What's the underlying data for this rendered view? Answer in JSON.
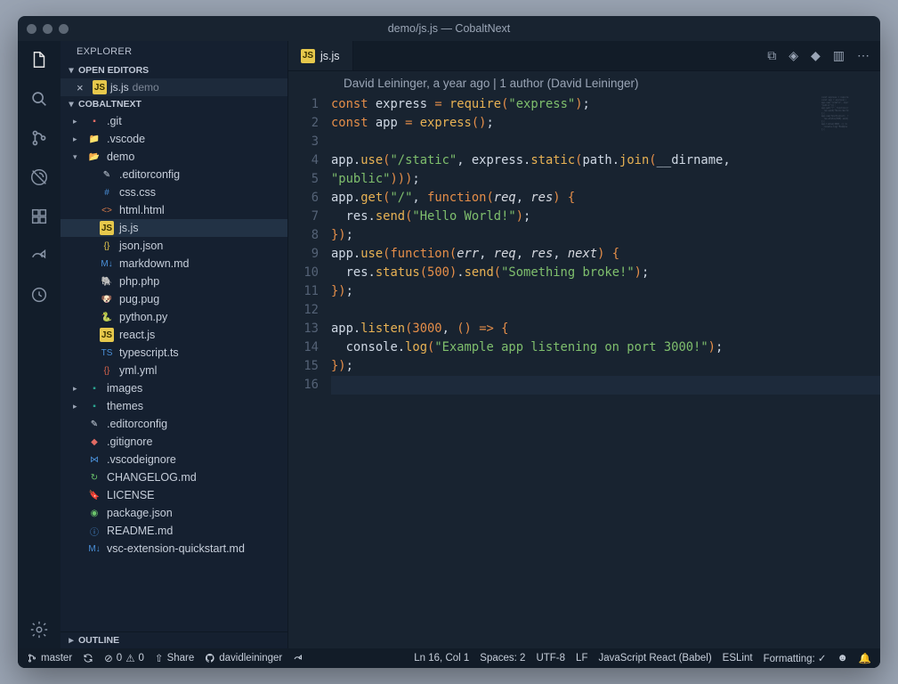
{
  "window_title": "demo/js.js — CobaltNext",
  "sidebar": {
    "title": "EXPLORER",
    "open_editors_label": "OPEN EDITORS",
    "open_file": {
      "name": "js.js",
      "dim": "demo"
    },
    "project_label": "COBALTNEXT",
    "outline_label": "OUTLINE",
    "tree": [
      {
        "name": ".git",
        "type": "folder",
        "indent": 1,
        "open": false,
        "icon": "folder-git",
        "color": "#e26b63"
      },
      {
        "name": ".vscode",
        "type": "folder",
        "indent": 1,
        "open": false,
        "icon": "folder",
        "color": "#5a6b82"
      },
      {
        "name": "demo",
        "type": "folder",
        "indent": 1,
        "open": true,
        "icon": "folder-open",
        "color": "#5a6b82"
      },
      {
        "name": ".editorconfig",
        "type": "file",
        "indent": 2,
        "icon": "mouse",
        "color": "#cfd8e4"
      },
      {
        "name": "css.css",
        "type": "file",
        "indent": 2,
        "icon": "css",
        "color": "#4a90d9"
      },
      {
        "name": "html.html",
        "type": "file",
        "indent": 2,
        "icon": "html",
        "color": "#d97b4a"
      },
      {
        "name": "js.js",
        "type": "file",
        "indent": 2,
        "icon": "js",
        "color": "#e6c84c",
        "selected": true
      },
      {
        "name": "json.json",
        "type": "file",
        "indent": 2,
        "icon": "json",
        "color": "#e6c84c"
      },
      {
        "name": "markdown.md",
        "type": "file",
        "indent": 2,
        "icon": "md",
        "color": "#4a90d9"
      },
      {
        "name": "php.php",
        "type": "file",
        "indent": 2,
        "icon": "php",
        "color": "#a77bbd"
      },
      {
        "name": "pug.pug",
        "type": "file",
        "indent": 2,
        "icon": "pug",
        "color": "#c79a76"
      },
      {
        "name": "python.py",
        "type": "file",
        "indent": 2,
        "icon": "python",
        "color": "#e6c84c"
      },
      {
        "name": "react.js",
        "type": "file",
        "indent": 2,
        "icon": "js",
        "color": "#e6c84c"
      },
      {
        "name": "typescript.ts",
        "type": "file",
        "indent": 2,
        "icon": "ts",
        "color": "#4a90d9"
      },
      {
        "name": "yml.yml",
        "type": "file",
        "indent": 2,
        "icon": "yml",
        "color": "#d9634a"
      },
      {
        "name": "images",
        "type": "folder",
        "indent": 1,
        "open": false,
        "icon": "folder-images",
        "color": "#2aa38f"
      },
      {
        "name": "themes",
        "type": "folder",
        "indent": 1,
        "open": false,
        "icon": "folder-themes",
        "color": "#2aa38f"
      },
      {
        "name": ".editorconfig",
        "type": "file",
        "indent": 1,
        "icon": "mouse",
        "color": "#cfd8e4"
      },
      {
        "name": ".gitignore",
        "type": "file",
        "indent": 1,
        "icon": "git",
        "color": "#e26b63"
      },
      {
        "name": ".vscodeignore",
        "type": "file",
        "indent": 1,
        "icon": "vscode",
        "color": "#4a90d9"
      },
      {
        "name": "CHANGELOG.md",
        "type": "file",
        "indent": 1,
        "icon": "changelog",
        "color": "#6bc46b"
      },
      {
        "name": "LICENSE",
        "type": "file",
        "indent": 1,
        "icon": "license",
        "color": "#d96b6b"
      },
      {
        "name": "package.json",
        "type": "file",
        "indent": 1,
        "icon": "npm",
        "color": "#6bc46b"
      },
      {
        "name": "README.md",
        "type": "file",
        "indent": 1,
        "icon": "readme",
        "color": "#4a90d9"
      },
      {
        "name": "vsc-extension-quickstart.md",
        "type": "file",
        "indent": 1,
        "icon": "md",
        "color": "#4a90d9"
      }
    ]
  },
  "tab": {
    "name": "js.js"
  },
  "blame": "David Leininger, a year ago | 1 author (David Leininger)",
  "code_lines": [
    {
      "n": 1,
      "html": "<span class='kw'>const</span> <span class='id'>express</span> <span class='op'>=</span> <span class='fn'>require</span><span class='par'>(</span><span class='str'>\"express\"</span><span class='par'>)</span>;"
    },
    {
      "n": 2,
      "html": "<span class='kw'>const</span> <span class='id'>app</span> <span class='op'>=</span> <span class='fn'>express</span><span class='par'>()</span>;"
    },
    {
      "n": 3,
      "html": ""
    },
    {
      "n": 4,
      "html": "<span class='id'>app</span><span class='dot'>.</span><span class='fn'>use</span><span class='par'>(</span><span class='str'>\"/static\"</span>, <span class='id'>express</span><span class='dot'>.</span><span class='fn'>static</span><span class='par'>(</span><span class='id'>path</span><span class='dot'>.</span><span class='fn'>join</span><span class='par'>(</span><span class='id'>__dirname</span>,"
    },
    {
      "n": 5,
      "html": "<span class='str'>\"public\"</span><span class='par'>)))</span>;"
    },
    {
      "n": 5,
      "blank": true,
      "override": 5,
      "skip": true
    },
    {
      "n": 6,
      "html": "<span class='id'>app</span><span class='dot'>.</span><span class='fn'>get</span><span class='par'>(</span><span class='str'>\"/\"</span>, <span class='kw'>function</span><span class='par'>(</span><span class='arg'>req</span>, <span class='arg'>res</span><span class='par'>)</span> <span class='par'>{</span>"
    },
    {
      "n": 7,
      "html": "  <span class='id'>res</span><span class='dot'>.</span><span class='fn'>send</span><span class='par'>(</span><span class='str'>\"Hello World!\"</span><span class='par'>)</span>;"
    },
    {
      "n": 8,
      "html": "<span class='par'>})</span>;"
    },
    {
      "n": 9,
      "html": "<span class='id'>app</span><span class='dot'>.</span><span class='fn'>use</span><span class='par'>(</span><span class='kw'>function</span><span class='par'>(</span><span class='arg'>err</span>, <span class='arg'>req</span>, <span class='arg'>res</span>, <span class='arg'>next</span><span class='par'>)</span> <span class='par'>{</span>"
    },
    {
      "n": 10,
      "html": "  <span class='id'>res</span><span class='dot'>.</span><span class='fn'>status</span><span class='par'>(</span><span class='num'>500</span><span class='par'>)</span><span class='dot'>.</span><span class='fn'>send</span><span class='par'>(</span><span class='str'>\"Something broke!\"</span><span class='par'>)</span>;"
    },
    {
      "n": 11,
      "html": "<span class='par'>})</span>;"
    },
    {
      "n": 12,
      "html": ""
    },
    {
      "n": 13,
      "html": "<span class='id'>app</span><span class='dot'>.</span><span class='fn'>listen</span><span class='par'>(</span><span class='num'>3000</span>, <span class='par'>()</span> <span class='op'>=></span> <span class='par'>{</span>"
    },
    {
      "n": 14,
      "html": "  <span class='id'>console</span><span class='dot'>.</span><span class='fn'>log</span><span class='par'>(</span><span class='str'>\"Example app listening on port 3000!\"</span><span class='par'>)</span>;"
    },
    {
      "n": 15,
      "html": "<span class='par'>})</span>;"
    },
    {
      "n": 16,
      "html": "",
      "current": true
    }
  ],
  "status": {
    "branch": "master",
    "errors": "0",
    "warnings": "0",
    "share": "Share",
    "user": "davidleininger",
    "cursor": "Ln 16, Col 1",
    "spaces": "Spaces: 2",
    "encoding": "UTF-8",
    "eol": "LF",
    "lang": "JavaScript React (Babel)",
    "lint": "ESLint",
    "format": "Formatting: ✓"
  }
}
